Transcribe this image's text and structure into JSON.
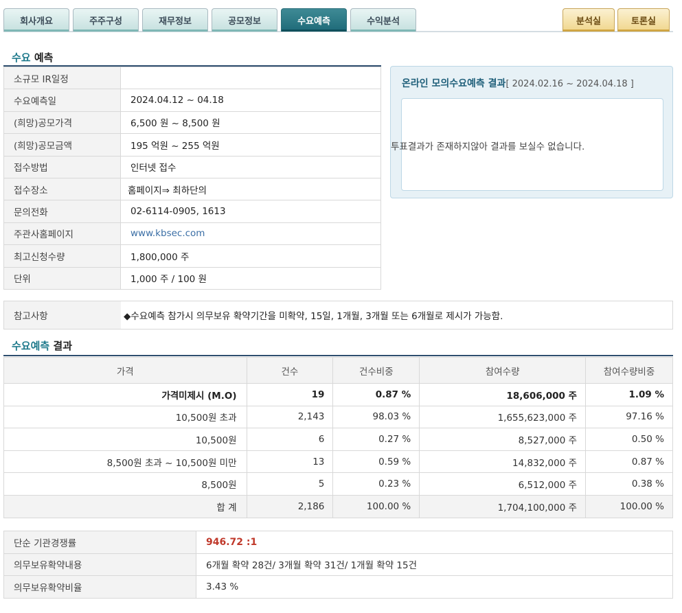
{
  "tabs": [
    {
      "label": "회사개요"
    },
    {
      "label": "주주구성"
    },
    {
      "label": "재무정보"
    },
    {
      "label": "공모정보"
    },
    {
      "label": "수요예측"
    },
    {
      "label": "수익분석"
    }
  ],
  "right_tabs": [
    {
      "label": "분석실"
    },
    {
      "label": "토론실"
    }
  ],
  "section1": {
    "hl": "수요",
    "rest": " 예측"
  },
  "info": [
    {
      "label": "소규모 IR일정",
      "value": ""
    },
    {
      "label": "수요예측일",
      "value": "2024.04.12 ~ 04.18"
    },
    {
      "label": "(희망)공모가격",
      "value": "6,500 원 ~ 8,500 원"
    },
    {
      "label": "(희망)공모금액",
      "value": "195 억원 ~ 255 억원"
    },
    {
      "label": "접수방법",
      "value": "인터넷 접수"
    },
    {
      "label": "접수장소",
      "value": "홈페이지⇒ 최하단의"
    },
    {
      "label": "문의전화",
      "value": "02-6114-0905, 1613"
    },
    {
      "label": "주관사홈페이지",
      "value": "www.kbsec.com"
    },
    {
      "label": "최고신청수량",
      "value": "1,800,000 주"
    },
    {
      "label": "단위",
      "value": "1,000 주 / 100 원"
    }
  ],
  "online": {
    "title": "온라인 모의수요예측 결과",
    "period": "[ 2024.02.16 ~ 2024.04.18 ]",
    "message": "투표결과가 존재하지않아 결과를 보실수 없습니다."
  },
  "note": {
    "label": "참고사항",
    "value": "◆수요예측 참가시 의무보유 확약기간을 미확약, 15일, 1개월, 3개월 또는 6개월로 제시가 가능함."
  },
  "section2": {
    "hl": "수요예측",
    "rest": " 결과"
  },
  "result": {
    "headers": [
      "가격",
      "건수",
      "건수비중",
      "참여수량",
      "참여수량비중"
    ],
    "rows": [
      [
        "가격미제시 (M.O)",
        "19",
        "0.87 %",
        "18,606,000 주",
        "1.09 %"
      ],
      [
        "10,500원 초과",
        "2,143",
        "98.03 %",
        "1,655,623,000 주",
        "97.16 %"
      ],
      [
        "10,500원",
        "6",
        "0.27 %",
        "8,527,000 주",
        "0.50 %"
      ],
      [
        "8,500원 초과 ~ 10,500원 미만",
        "13",
        "0.59 %",
        "14,832,000 주",
        "0.87 %"
      ],
      [
        "8,500원",
        "5",
        "0.23 %",
        "6,512,000 주",
        "0.38 %"
      ],
      [
        "합 계",
        "2,186",
        "100.00 %",
        "1,704,100,000 주",
        "100.00 %"
      ]
    ]
  },
  "bottom": [
    {
      "label": "단순 기관경쟁률",
      "value": "946.72 :1"
    },
    {
      "label": "의무보유확약내용",
      "value": "6개월 확약 28건/ 3개월 확약 31건/ 1개월 확약 15건"
    },
    {
      "label": "의무보유확약비율",
      "value": "3.43 %"
    }
  ]
}
